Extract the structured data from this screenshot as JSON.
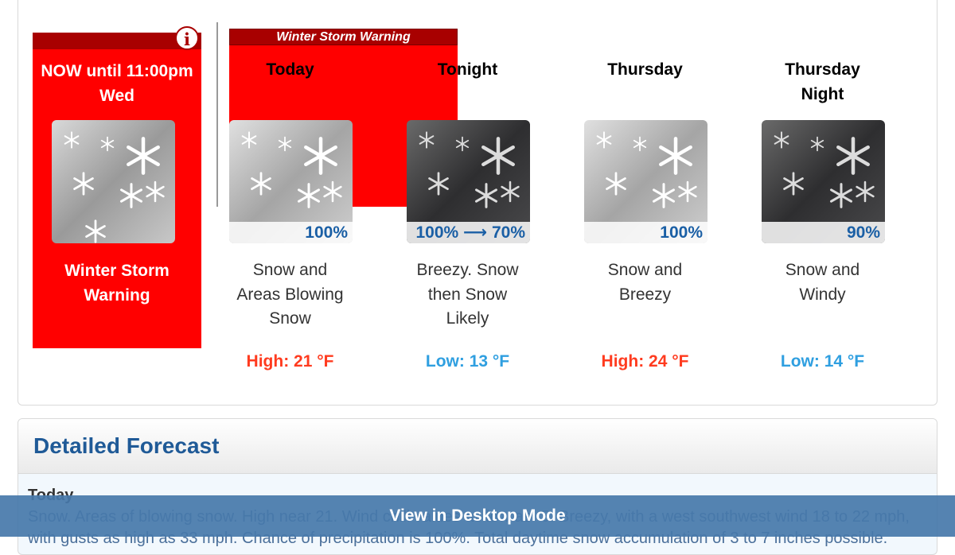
{
  "warning_card": {
    "period": "NOW until\n11:00pm Wed",
    "label": "Winter Storm\nWarning",
    "info_icon": "i"
  },
  "banner": {
    "text": "Winter Storm Warning"
  },
  "forecast": [
    {
      "title": "Today",
      "pct": "100%",
      "desc": "Snow and\nAreas Blowing\nSnow",
      "temp": "High: 21 °F",
      "kind": "high",
      "sky": "day"
    },
    {
      "title": "Tonight",
      "pct": "100% ⟶ 70%",
      "desc": "Breezy. Snow\nthen Snow\nLikely",
      "temp": "Low: 13 °F",
      "kind": "low",
      "sky": "night"
    },
    {
      "title": "Thursday",
      "pct": "100%",
      "desc": "Snow and\nBreezy",
      "temp": "High: 24 °F",
      "kind": "high",
      "sky": "day"
    },
    {
      "title": "Thursday\nNight",
      "pct": "90%",
      "desc": "Snow and\nWindy",
      "temp": "Low: 14 °F",
      "kind": "low",
      "sky": "night"
    }
  ],
  "detailed": {
    "heading": "Detailed Forecast",
    "first_day": "Today",
    "first_text": "Snow. Areas of blowing snow. High near 21. Wind chill values as low as -5. Breezy, with a west southwest wind 18 to 22 mph, with gusts as high as 33 mph. Chance of precipitation is 100%. Total daytime snow accumulation of 3 to 7 inches possible."
  },
  "desktop_mode": {
    "label": "View in Desktop Mode"
  },
  "colors": {
    "warning_red": "#ff0000",
    "dark_red": "#a80000",
    "high_temp": "#ff3b1f",
    "low_temp": "#2f9fe0",
    "heading_blue": "#1f5a97"
  }
}
